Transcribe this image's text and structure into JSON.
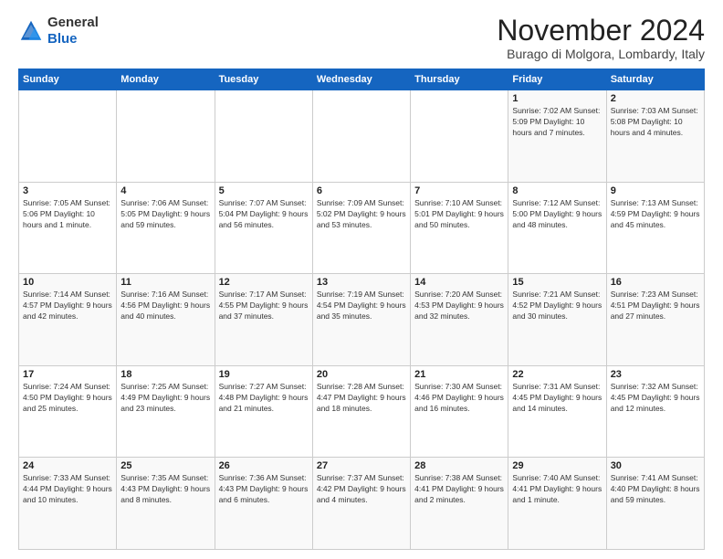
{
  "header": {
    "logo_general": "General",
    "logo_blue": "Blue",
    "month_title": "November 2024",
    "location": "Burago di Molgora, Lombardy, Italy"
  },
  "days_of_week": [
    "Sunday",
    "Monday",
    "Tuesday",
    "Wednesday",
    "Thursday",
    "Friday",
    "Saturday"
  ],
  "weeks": [
    [
      {
        "day": "",
        "info": ""
      },
      {
        "day": "",
        "info": ""
      },
      {
        "day": "",
        "info": ""
      },
      {
        "day": "",
        "info": ""
      },
      {
        "day": "",
        "info": ""
      },
      {
        "day": "1",
        "info": "Sunrise: 7:02 AM\nSunset: 5:09 PM\nDaylight: 10 hours\nand 7 minutes."
      },
      {
        "day": "2",
        "info": "Sunrise: 7:03 AM\nSunset: 5:08 PM\nDaylight: 10 hours\nand 4 minutes."
      }
    ],
    [
      {
        "day": "3",
        "info": "Sunrise: 7:05 AM\nSunset: 5:06 PM\nDaylight: 10 hours\nand 1 minute."
      },
      {
        "day": "4",
        "info": "Sunrise: 7:06 AM\nSunset: 5:05 PM\nDaylight: 9 hours\nand 59 minutes."
      },
      {
        "day": "5",
        "info": "Sunrise: 7:07 AM\nSunset: 5:04 PM\nDaylight: 9 hours\nand 56 minutes."
      },
      {
        "day": "6",
        "info": "Sunrise: 7:09 AM\nSunset: 5:02 PM\nDaylight: 9 hours\nand 53 minutes."
      },
      {
        "day": "7",
        "info": "Sunrise: 7:10 AM\nSunset: 5:01 PM\nDaylight: 9 hours\nand 50 minutes."
      },
      {
        "day": "8",
        "info": "Sunrise: 7:12 AM\nSunset: 5:00 PM\nDaylight: 9 hours\nand 48 minutes."
      },
      {
        "day": "9",
        "info": "Sunrise: 7:13 AM\nSunset: 4:59 PM\nDaylight: 9 hours\nand 45 minutes."
      }
    ],
    [
      {
        "day": "10",
        "info": "Sunrise: 7:14 AM\nSunset: 4:57 PM\nDaylight: 9 hours\nand 42 minutes."
      },
      {
        "day": "11",
        "info": "Sunrise: 7:16 AM\nSunset: 4:56 PM\nDaylight: 9 hours\nand 40 minutes."
      },
      {
        "day": "12",
        "info": "Sunrise: 7:17 AM\nSunset: 4:55 PM\nDaylight: 9 hours\nand 37 minutes."
      },
      {
        "day": "13",
        "info": "Sunrise: 7:19 AM\nSunset: 4:54 PM\nDaylight: 9 hours\nand 35 minutes."
      },
      {
        "day": "14",
        "info": "Sunrise: 7:20 AM\nSunset: 4:53 PM\nDaylight: 9 hours\nand 32 minutes."
      },
      {
        "day": "15",
        "info": "Sunrise: 7:21 AM\nSunset: 4:52 PM\nDaylight: 9 hours\nand 30 minutes."
      },
      {
        "day": "16",
        "info": "Sunrise: 7:23 AM\nSunset: 4:51 PM\nDaylight: 9 hours\nand 27 minutes."
      }
    ],
    [
      {
        "day": "17",
        "info": "Sunrise: 7:24 AM\nSunset: 4:50 PM\nDaylight: 9 hours\nand 25 minutes."
      },
      {
        "day": "18",
        "info": "Sunrise: 7:25 AM\nSunset: 4:49 PM\nDaylight: 9 hours\nand 23 minutes."
      },
      {
        "day": "19",
        "info": "Sunrise: 7:27 AM\nSunset: 4:48 PM\nDaylight: 9 hours\nand 21 minutes."
      },
      {
        "day": "20",
        "info": "Sunrise: 7:28 AM\nSunset: 4:47 PM\nDaylight: 9 hours\nand 18 minutes."
      },
      {
        "day": "21",
        "info": "Sunrise: 7:30 AM\nSunset: 4:46 PM\nDaylight: 9 hours\nand 16 minutes."
      },
      {
        "day": "22",
        "info": "Sunrise: 7:31 AM\nSunset: 4:45 PM\nDaylight: 9 hours\nand 14 minutes."
      },
      {
        "day": "23",
        "info": "Sunrise: 7:32 AM\nSunset: 4:45 PM\nDaylight: 9 hours\nand 12 minutes."
      }
    ],
    [
      {
        "day": "24",
        "info": "Sunrise: 7:33 AM\nSunset: 4:44 PM\nDaylight: 9 hours\nand 10 minutes."
      },
      {
        "day": "25",
        "info": "Sunrise: 7:35 AM\nSunset: 4:43 PM\nDaylight: 9 hours\nand 8 minutes."
      },
      {
        "day": "26",
        "info": "Sunrise: 7:36 AM\nSunset: 4:43 PM\nDaylight: 9 hours\nand 6 minutes."
      },
      {
        "day": "27",
        "info": "Sunrise: 7:37 AM\nSunset: 4:42 PM\nDaylight: 9 hours\nand 4 minutes."
      },
      {
        "day": "28",
        "info": "Sunrise: 7:38 AM\nSunset: 4:41 PM\nDaylight: 9 hours\nand 2 minutes."
      },
      {
        "day": "29",
        "info": "Sunrise: 7:40 AM\nSunset: 4:41 PM\nDaylight: 9 hours\nand 1 minute."
      },
      {
        "day": "30",
        "info": "Sunrise: 7:41 AM\nSunset: 4:40 PM\nDaylight: 8 hours\nand 59 minutes."
      }
    ]
  ]
}
